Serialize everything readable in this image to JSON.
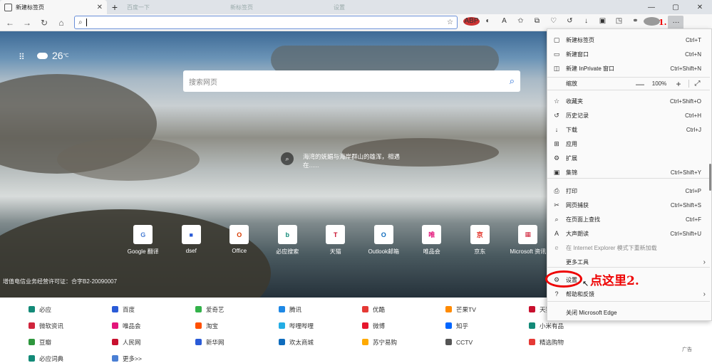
{
  "tabs": [
    {
      "title": "新建标签页",
      "active": true
    },
    {
      "title": "百度一下",
      "active": false
    },
    {
      "title": "新标签页",
      "active": false
    },
    {
      "title": "设置",
      "active": false
    }
  ],
  "toolbar": {
    "address_value": "",
    "annotation_1": "1."
  },
  "newtab": {
    "temperature": "26",
    "temp_unit": "℃",
    "search_placeholder": "搜索网页",
    "image_caption_line1": "海湾的妩媚与海岸群山的雄浑，相遇",
    "image_caption_line2": "在......",
    "icp": "增值电信业务经营许可证：合字B2-20090007",
    "tiles": [
      {
        "label": "Google 翻译",
        "glyph": "G",
        "color": "#4a7fd4"
      },
      {
        "label": "dsef",
        "glyph": "■",
        "color": "#2a5bd7"
      },
      {
        "label": "Office",
        "glyph": "O",
        "color": "#d83b01"
      },
      {
        "label": "必应搜索",
        "glyph": "b",
        "color": "#138a78"
      },
      {
        "label": "天猫",
        "glyph": "T",
        "color": "#c8102e"
      },
      {
        "label": "Outlook邮箱",
        "glyph": "O",
        "color": "#0f6cbd"
      },
      {
        "label": "唯品会",
        "glyph": "唯",
        "color": "#e3147a"
      },
      {
        "label": "京东",
        "glyph": "京",
        "color": "#e1251b"
      },
      {
        "label": "Microsoft 资讯",
        "glyph": "▦",
        "color": "#d0243c"
      }
    ],
    "news": [
      {
        "label": "必应",
        "color": "#138a78"
      },
      {
        "label": "百度",
        "color": "#2a5bd7"
      },
      {
        "label": "爱奇艺",
        "color": "#33b24a"
      },
      {
        "label": "腾讯",
        "color": "#1e88e5"
      },
      {
        "label": "优酷",
        "color": "#e53935"
      },
      {
        "label": "芒果TV",
        "color": "#ff8a00"
      },
      {
        "label": "天猫",
        "color": "#c8102e"
      },
      {
        "label": "微软资讯",
        "color": "#d0243c"
      },
      {
        "label": "唯品会",
        "color": "#e3147a"
      },
      {
        "label": "淘宝",
        "color": "#ff5000"
      },
      {
        "label": "哔哩哔哩",
        "color": "#23ade5"
      },
      {
        "label": "微博",
        "color": "#e6162d"
      },
      {
        "label": "知乎",
        "color": "#0066ff"
      },
      {
        "label": "小米有品",
        "color": "#138a78"
      },
      {
        "label": "豆瓣",
        "color": "#2e963d"
      },
      {
        "label": "人民网",
        "color": "#c8102e"
      },
      {
        "label": "新华网",
        "color": "#2a5bd7"
      },
      {
        "label": "欢太商城",
        "color": "#0f6cbd"
      },
      {
        "label": "苏宁易购",
        "color": "#ffaa00"
      },
      {
        "label": "CCTV",
        "color": "#555555"
      },
      {
        "label": "精选购物",
        "color": "#e53935"
      },
      {
        "label": "必应词典",
        "color": "#138a78"
      },
      {
        "label": "更多>>",
        "color": "#4a7fd4"
      }
    ],
    "ad_label": "广告"
  },
  "menu": {
    "items": [
      {
        "label": "新建标签页",
        "shortcut": "Ctrl+T",
        "icon": "▢"
      },
      {
        "label": "新建窗口",
        "shortcut": "Ctrl+N",
        "icon": "▭"
      },
      {
        "label": "新建 InPrivate 窗口",
        "shortcut": "Ctrl+Shift+N",
        "icon": "◫"
      },
      {
        "label": "缩放",
        "shortcut": "",
        "icon": ""
      },
      {
        "label": "收藏夹",
        "shortcut": "Ctrl+Shift+O",
        "icon": "☆"
      },
      {
        "label": "历史记录",
        "shortcut": "Ctrl+H",
        "icon": "↺"
      },
      {
        "label": "下载",
        "shortcut": "Ctrl+J",
        "icon": "↓"
      },
      {
        "label": "应用",
        "shortcut": "",
        "icon": "⊞"
      },
      {
        "label": "扩展",
        "shortcut": "",
        "icon": "⚙"
      },
      {
        "label": "集锦",
        "shortcut": "Ctrl+Shift+Y",
        "icon": "▣"
      },
      {
        "label": "打印",
        "shortcut": "Ctrl+P",
        "icon": "⎙"
      },
      {
        "label": "网页捕获",
        "shortcut": "Ctrl+Shift+S",
        "icon": "✂"
      },
      {
        "label": "在页面上查找",
        "shortcut": "Ctrl+F",
        "icon": "⌕"
      },
      {
        "label": "大声朗读",
        "shortcut": "Ctrl+Shift+U",
        "icon": "A"
      },
      {
        "label": "在 Internet Explorer 模式下重新加载",
        "shortcut": "",
        "icon": "e"
      },
      {
        "label": "更多工具",
        "shortcut": "",
        "icon": ""
      },
      {
        "label": "设置",
        "shortcut": "",
        "icon": "⚙"
      },
      {
        "label": "帮助和反馈",
        "shortcut": "",
        "icon": "?"
      },
      {
        "label": "关闭 Microsoft Edge",
        "shortcut": "",
        "icon": ""
      }
    ],
    "zoom_value": "100%",
    "zoom_minus": "—",
    "zoom_plus": "+",
    "annotation_click": "点这里2."
  }
}
